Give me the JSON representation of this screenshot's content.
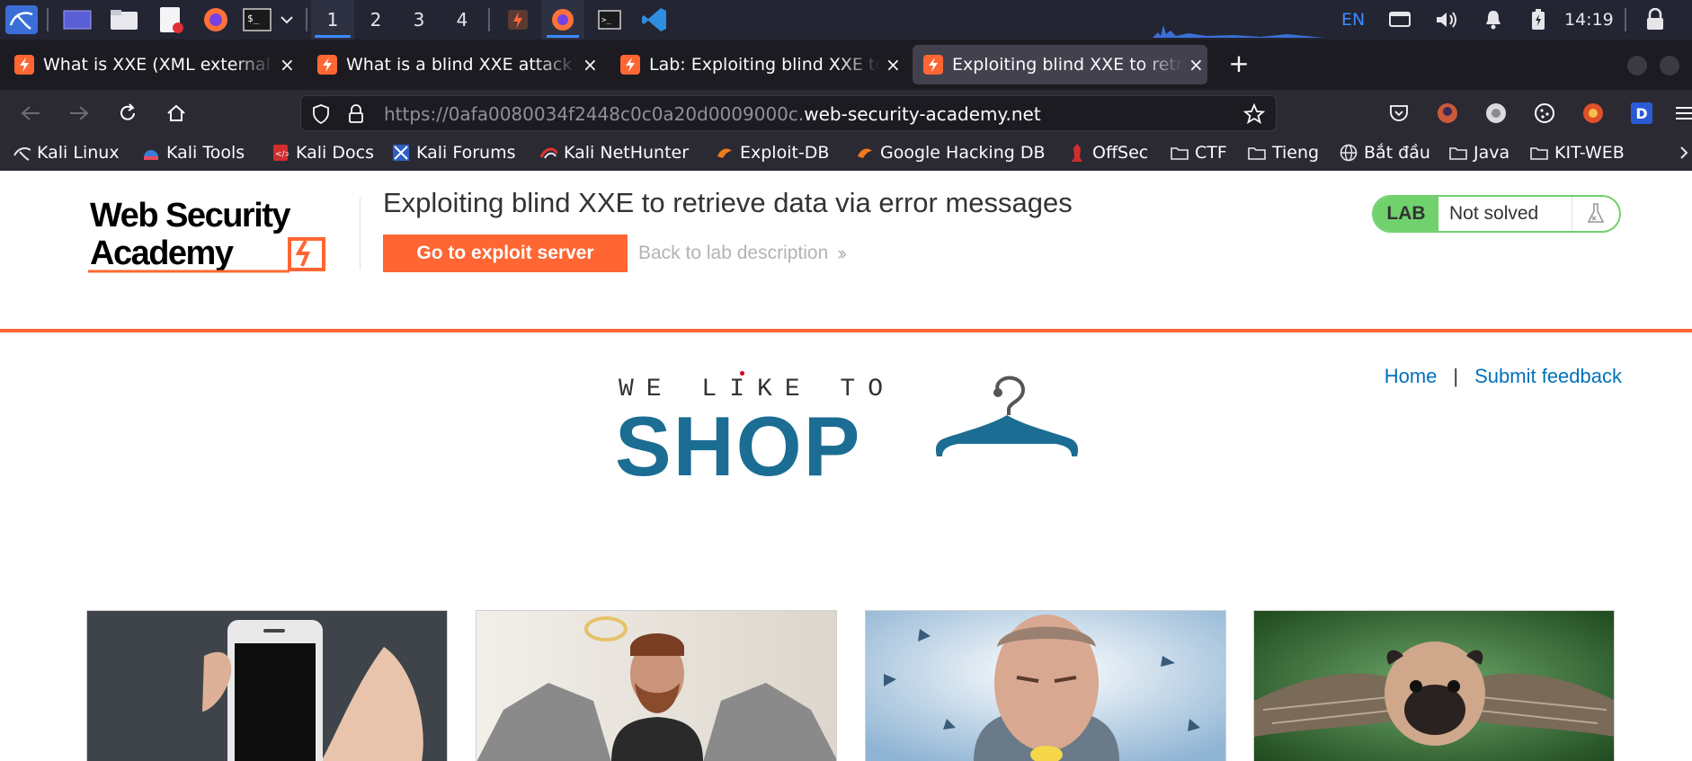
{
  "taskbar": {
    "workspaces": [
      "1",
      "2",
      "3",
      "4"
    ],
    "active_workspace": "1",
    "language": "EN",
    "clock": "14:19"
  },
  "tabs": [
    {
      "title": "What is XXE (XML external entity) injection?",
      "active": false
    },
    {
      "title": "What is a blind XXE attack?",
      "active": false
    },
    {
      "title": "Lab: Exploiting blind XXE to retrieve data via error messages",
      "active": false
    },
    {
      "title": "Exploiting blind XXE to retrieve data via error messages",
      "active": true
    }
  ],
  "new_tab_label": "+",
  "close_label": "×",
  "navbar": {
    "url_prefix": "https://0afa0080034f2448c0c0a20d0009000c.",
    "url_host": "web-security-academy.net",
    "extension_letter": "D"
  },
  "bookmarks": [
    {
      "label": "Kali Linux",
      "icon": "kali-icon"
    },
    {
      "label": "Kali Tools",
      "icon": "kali-tools-icon"
    },
    {
      "label": "Kali Docs",
      "icon": "kali-docs-icon"
    },
    {
      "label": "Kali Forums",
      "icon": "kali-forums-icon"
    },
    {
      "label": "Kali NetHunter",
      "icon": "nethunter-icon"
    },
    {
      "label": "Exploit-DB",
      "icon": "exploit-db-icon"
    },
    {
      "label": "Google Hacking DB",
      "icon": "exploit-db-icon"
    },
    {
      "label": "OffSec",
      "icon": "offsec-icon"
    },
    {
      "label": "CTF",
      "icon": "folder-icon"
    },
    {
      "label": "Tieng",
      "icon": "folder-icon"
    },
    {
      "label": "Bắt đầu",
      "icon": "globe-icon"
    },
    {
      "label": "Java",
      "icon": "folder-icon"
    },
    {
      "label": "KIT-WEB",
      "icon": "folder-icon"
    }
  ],
  "lab_header": {
    "logo_line1": "Web Security",
    "logo_line2": "Academy",
    "title": "Exploiting blind XXE to retrieve data via error messages",
    "exploit_button": "Go to exploit server",
    "back_link": "Back to lab description",
    "status_badge": "LAB",
    "status_text": "Not solved"
  },
  "site_nav": {
    "home": "Home",
    "separator": "|",
    "feedback": "Submit feedback"
  },
  "banner": {
    "small_text": "WE LIKE TO",
    "big_text": "SHOP"
  },
  "colors": {
    "accent_orange": "#ff6633",
    "lab_green": "#70d16d",
    "link_blue": "#0071bc",
    "shop_blue": "#1b6d93"
  },
  "products": [
    {
      "image": "smartphone-in-hand"
    },
    {
      "image": "man-with-angel-wings"
    },
    {
      "image": "man-biting-lemon"
    },
    {
      "image": "pug-with-owl-wings"
    }
  ]
}
